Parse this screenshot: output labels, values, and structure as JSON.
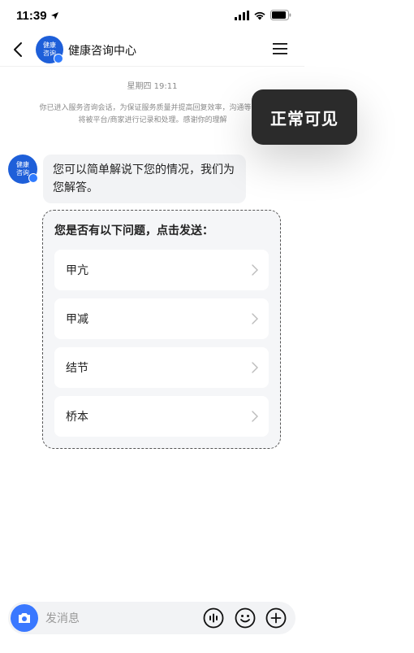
{
  "status_bar": {
    "time": "11:39"
  },
  "nav": {
    "avatar_text": "健康咨询",
    "title": "健康咨询中心"
  },
  "chat": {
    "timestamp": "星期四 19:11",
    "system_notice": "你已进入服务咨询会话，为保证服务质量并提高回复效率，沟通等信息将被平台/商家进行记录和处理。感谢你的理解",
    "bot_avatar_text": "健康咨询",
    "bot_message": "您可以简单解说下您的情况，我们为您解答。"
  },
  "quick_questions": {
    "title": "您是否有以下问题，点击发送：",
    "items": [
      {
        "label": "甲亢"
      },
      {
        "label": "甲减"
      },
      {
        "label": "结节"
      },
      {
        "label": "桥本"
      }
    ]
  },
  "toast": {
    "text": "正常可见"
  },
  "input_bar": {
    "placeholder": "发消息"
  },
  "colors": {
    "accent": "#3a78ff",
    "avatar_bg": "#1e5fd9",
    "toast_bg": "#2b2b2b"
  }
}
